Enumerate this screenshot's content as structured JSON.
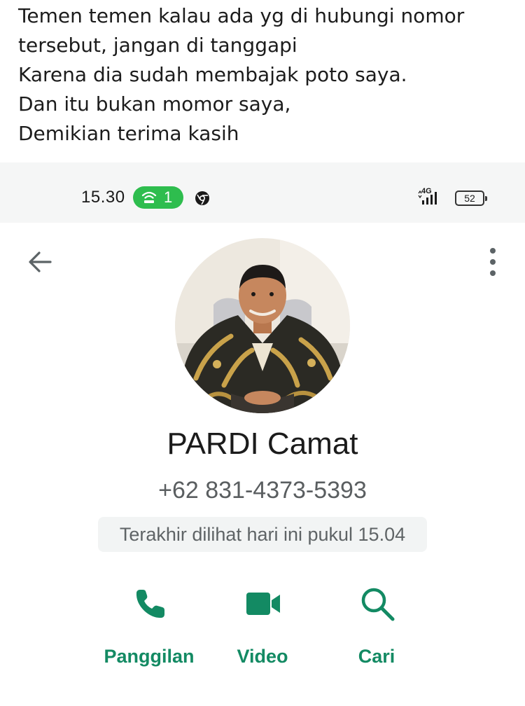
{
  "post": {
    "lines": [
      "Temen temen kalau ada yg di hubungi nomor",
      "tersebut, jangan di tanggapi",
      "Karena dia sudah membajak poto saya.",
      "Dan itu bukan momor saya,",
      "Demikian terima kasih"
    ]
  },
  "status_bar": {
    "time": "15.30",
    "hotspot_count": "1",
    "network_label": "4G",
    "battery_level": "52"
  },
  "contact": {
    "name": "PARDI Camat",
    "phone": "+62 831-4373-5393",
    "last_seen": "Terakhir dilihat hari ini pukul 15.04"
  },
  "actions": {
    "call_label": "Panggilan",
    "video_label": "Video",
    "search_label": "Cari"
  },
  "icons": {
    "back": "arrow-left-icon",
    "menu": "more-vertical-icon",
    "call": "phone-icon",
    "video": "video-camera-icon",
    "search": "search-icon"
  },
  "colors": {
    "accent": "#138a63",
    "hotspot": "#2ebd4e"
  }
}
